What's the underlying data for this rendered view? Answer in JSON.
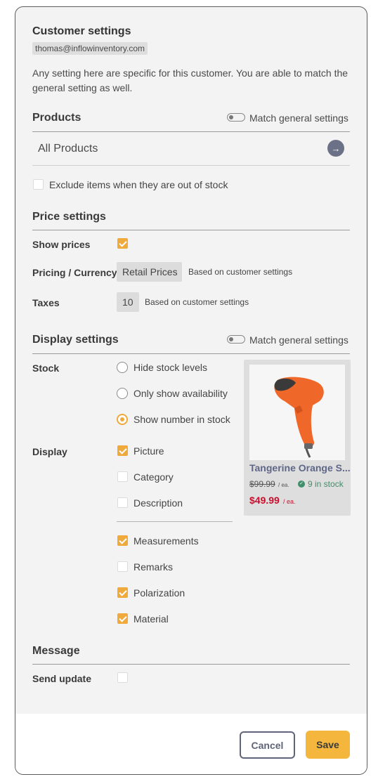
{
  "header": {
    "title": "Customer settings",
    "email": "thomas@inflowinventory.com",
    "description": "Any setting here are specific for this customer. You are able to match the general setting as well."
  },
  "products": {
    "title": "Products",
    "match_label": "Match general settings",
    "selector_label": "All Products",
    "exclude_label": "Exclude items when they are out of stock"
  },
  "price": {
    "title": "Price settings",
    "show_prices_label": "Show prices",
    "pricing_label": "Pricing / Currency",
    "pricing_value": "Retail Prices",
    "pricing_note": "Based on customer settings",
    "taxes_label": "Taxes",
    "taxes_value": "10",
    "taxes_note": "Based on customer settings"
  },
  "display": {
    "title": "Display settings",
    "match_label": "Match general settings",
    "stock_label": "Stock",
    "stock_options": [
      "Hide stock levels",
      "Only show availability",
      "Show number in stock"
    ],
    "stock_selected": "Show number in stock",
    "display_label": "Display",
    "display_options": [
      {
        "label": "Picture",
        "checked": true
      },
      {
        "label": "Category",
        "checked": false
      },
      {
        "label": "Description",
        "checked": false
      },
      {
        "label": "Measurements",
        "checked": true
      },
      {
        "label": "Remarks",
        "checked": false
      },
      {
        "label": "Polarization",
        "checked": true
      },
      {
        "label": "Material",
        "checked": true
      }
    ]
  },
  "preview": {
    "product_name": "Tangerine Orange S...",
    "old_price": "$99.99",
    "old_unit": "/ ea.",
    "stock": "9 in stock",
    "price": "$49.99",
    "unit": "/ ea."
  },
  "message": {
    "title": "Message",
    "send_update_label": "Send update"
  },
  "footer": {
    "cancel": "Cancel",
    "save": "Save"
  },
  "colors": {
    "accent": "#f0a93b",
    "save": "#f4b63c",
    "price_red": "#c8102e",
    "stock_green": "#3f8f6a",
    "link_blue": "#5f6788"
  }
}
